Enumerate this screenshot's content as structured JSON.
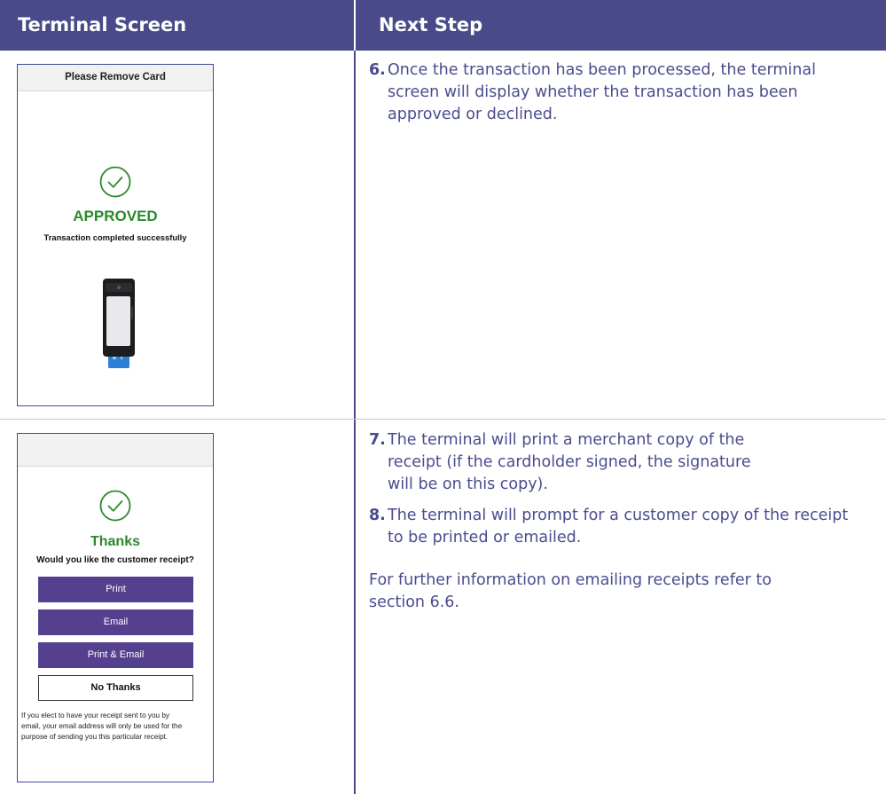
{
  "header": {
    "col1": "Terminal Screen",
    "col2": "Next Step"
  },
  "screen1": {
    "title": "Please Remove Card",
    "status": "APPROVED",
    "message": "Transaction completed successfully",
    "check_icon": "check-circle-icon",
    "device_icon": "card-terminal-icon",
    "status_color": "#2a8a2a"
  },
  "screen2": {
    "status": "Thanks",
    "question": "Would you like the customer receipt?",
    "buttons": [
      "Print",
      "Email",
      "Print & Email",
      "No Thanks"
    ],
    "note": "If you elect to have your receipt sent to you by email, your email address will only be used for the purpose of sending you this particular receipt.",
    "button_color": "#54408f"
  },
  "steps": {
    "s6": {
      "num": "6.",
      "text": "Once the transaction has been processed, the terminal screen will display whether the transaction has been approved or declined."
    },
    "s7": {
      "num": "7.",
      "text": "The terminal will print a merchant copy of the receipt (if the cardholder signed, the signature will be on this copy)."
    },
    "s8": {
      "num": "8.",
      "text": "The terminal will prompt for a customer copy of the receipt to be printed or emailed."
    },
    "further": "For further information on emailing receipts refer to section 6.6."
  },
  "colors": {
    "header_bg": "#4a4a8a",
    "step_text": "#4a4c8f",
    "border": "#3d4a9e"
  }
}
